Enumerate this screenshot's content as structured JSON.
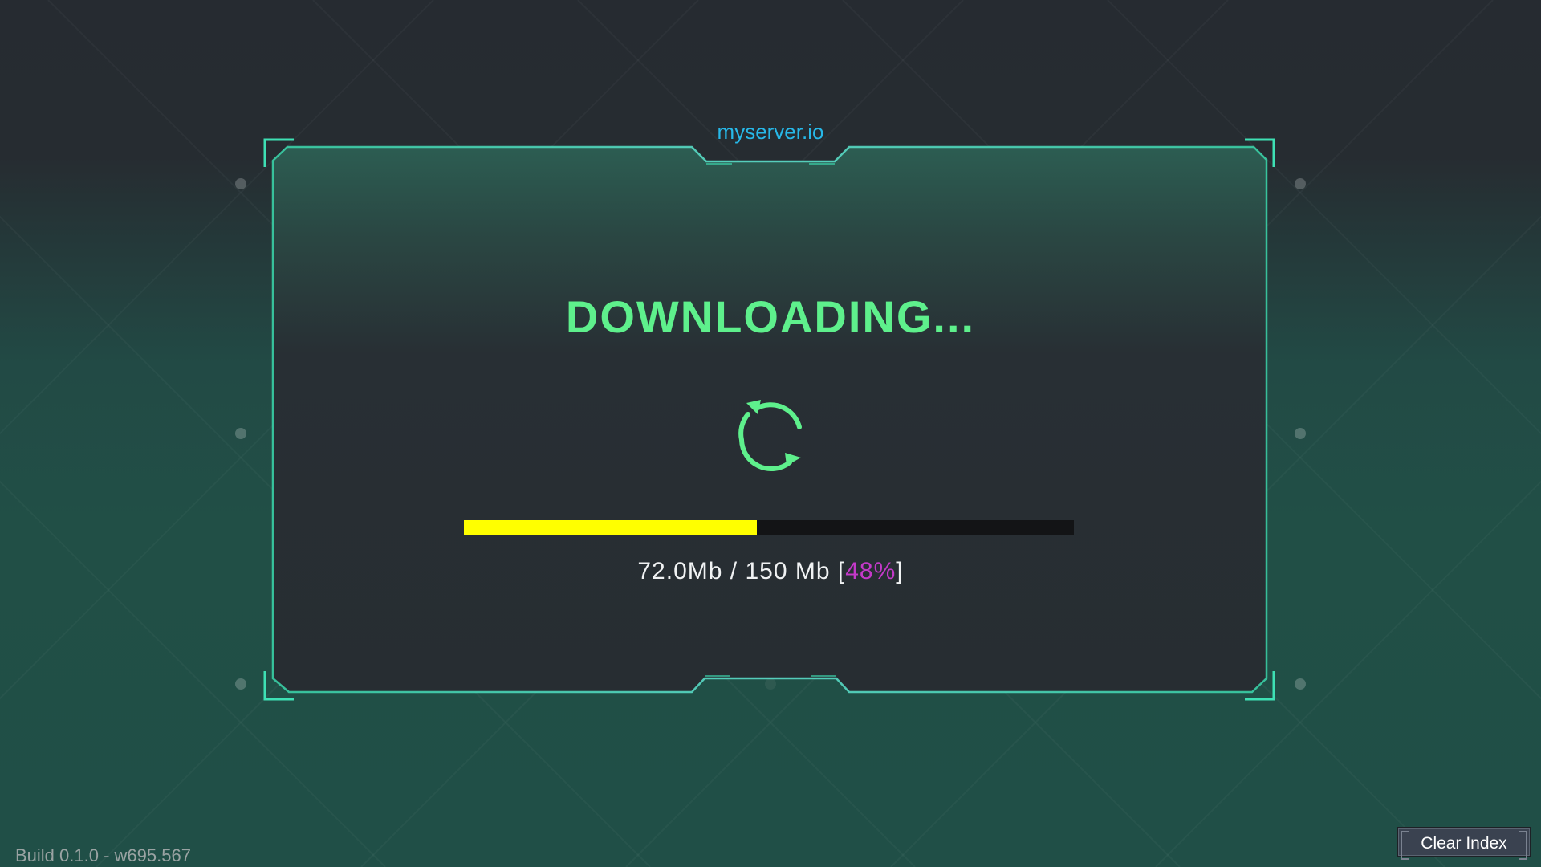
{
  "header": {
    "server_name": "myserver.io"
  },
  "main": {
    "status_title": "DOWNLOADING...",
    "spinner_icon": "refresh-cycle-icon",
    "progress": {
      "downloaded_label": "72.0Mb",
      "separator": " / ",
      "total_label": "150 Mb",
      "bracket_open": " [",
      "percent_label": "48%",
      "bracket_close": "]",
      "fraction": 0.48,
      "fill_color": "#ffff00",
      "track_color": "#131416"
    }
  },
  "footer": {
    "build_info": "Build 0.1.0 - w695.567",
    "clear_index_label": "Clear Index"
  },
  "colors": {
    "title": "#5ef08c",
    "server_name": "#27b8e8",
    "percent": "#c339c8",
    "frame_accent": "#3ee0b4"
  }
}
